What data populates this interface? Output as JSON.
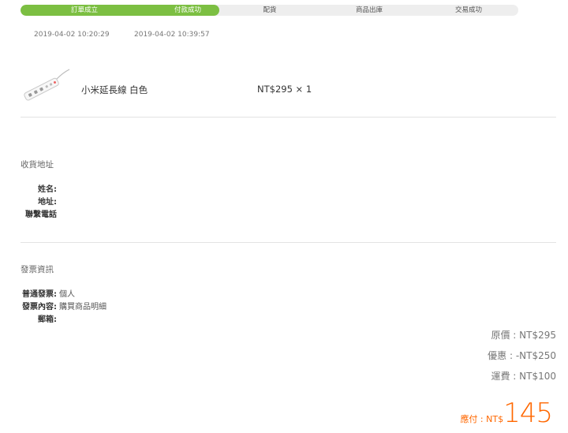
{
  "progress": {
    "steps": [
      {
        "label": "訂單成立",
        "done": true
      },
      {
        "label": "付款成功",
        "done": true
      },
      {
        "label": "配貨",
        "done": false
      },
      {
        "label": "商品出庫",
        "done": false
      },
      {
        "label": "交易成功",
        "done": false
      }
    ],
    "completed_fraction": 0.4,
    "accent_color": "#7cbf42"
  },
  "timestamps": [
    "2019-04-02 10:20:29",
    "2019-04-02 10:39:57"
  ],
  "product": {
    "name": "小米延長線 白色",
    "price_qty": "NT$295 × 1",
    "image_icon": "power-strip-icon"
  },
  "shipping": {
    "title": "收貨地址",
    "fields": [
      {
        "label": "姓名:",
        "value": ""
      },
      {
        "label": "地址:",
        "value": ""
      },
      {
        "label": "聯繫電話",
        "value": ""
      }
    ]
  },
  "invoice": {
    "title": "發票資訊",
    "fields": [
      {
        "label": "普通發票:",
        "value": "個人"
      },
      {
        "label": "發票內容:",
        "value": "購買商品明細"
      },
      {
        "label": "郵箱:",
        "value": ""
      }
    ]
  },
  "summary": {
    "original": "原價 : NT$295",
    "discount": "優惠 : -NT$250",
    "shipping": "運費 : NT$100",
    "total_label": "應付 : NT$",
    "total_amount": "145",
    "total_color": "#ff6700"
  }
}
